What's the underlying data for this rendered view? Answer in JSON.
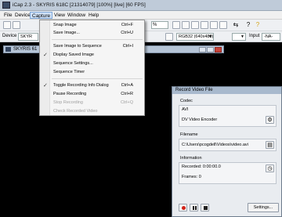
{
  "window": {
    "title": "iCap 2.3 - SKYRIS 618C [21314079] [100%] [live] [60 FPS]"
  },
  "menubar": {
    "items": [
      "File",
      "Device",
      "Capture",
      "View",
      "Window",
      "Help"
    ],
    "active": "Capture"
  },
  "toolbar": {
    "zoom_value": "%",
    "device_label": "Device",
    "device_value": "SKYR",
    "format_value": "RGB32 (640x480)",
    "input_label": "Input",
    "input_value": "-NA-"
  },
  "child_window": {
    "title": "SKYRIS 61"
  },
  "capture_menu": {
    "items": [
      {
        "label": "Snap Image",
        "shortcut": "Ctrl+F",
        "checked": false,
        "disabled": false
      },
      {
        "label": "Save Image...",
        "shortcut": "Ctrl+U",
        "checked": false,
        "disabled": false
      },
      {
        "label": "Save Image to Sequence",
        "shortcut": "Ctrl+I",
        "checked": false,
        "disabled": false
      },
      {
        "label": "Display Saved Image",
        "shortcut": "",
        "checked": true,
        "disabled": false
      },
      {
        "label": "Sequence Settings...",
        "shortcut": "",
        "checked": false,
        "disabled": false
      },
      {
        "label": "Sequence Timer",
        "shortcut": "",
        "checked": false,
        "disabled": false
      },
      {
        "label": "Toggle Recording Info Dialog",
        "shortcut": "Ctrl+A",
        "checked": true,
        "disabled": false
      },
      {
        "label": "Pause Recording",
        "shortcut": "Ctrl+R",
        "checked": false,
        "disabled": false
      },
      {
        "label": "Stop Recording",
        "shortcut": "Ctrl+Q",
        "checked": false,
        "disabled": true
      },
      {
        "label": "Check Recorded Video",
        "shortcut": "",
        "checked": false,
        "disabled": true
      }
    ],
    "check_glyph": "✓"
  },
  "record_dialog": {
    "title": "Record Video File",
    "codec_label": "Codec",
    "codec_container": "AVI",
    "codec_encoder": "DV Video Encoder",
    "filename_label": "Filename",
    "filename_value": "C:\\Users\\pcogdell\\Videos\\video.avi",
    "information_label": "Information",
    "recorded_text": "Recorded: 0:00:00.0",
    "frames_text": "Frames: 0",
    "settings_label": "Settings..."
  },
  "icons": {
    "toolbar_help": "?",
    "toolbar_arrow": "⇆",
    "clock": "◷",
    "folder": "▤",
    "settings": "⚙"
  },
  "colors": {
    "record_red": "#d2241a",
    "titlebar": "#bfcbd9",
    "menu_highlight": "#cfe1f7"
  }
}
